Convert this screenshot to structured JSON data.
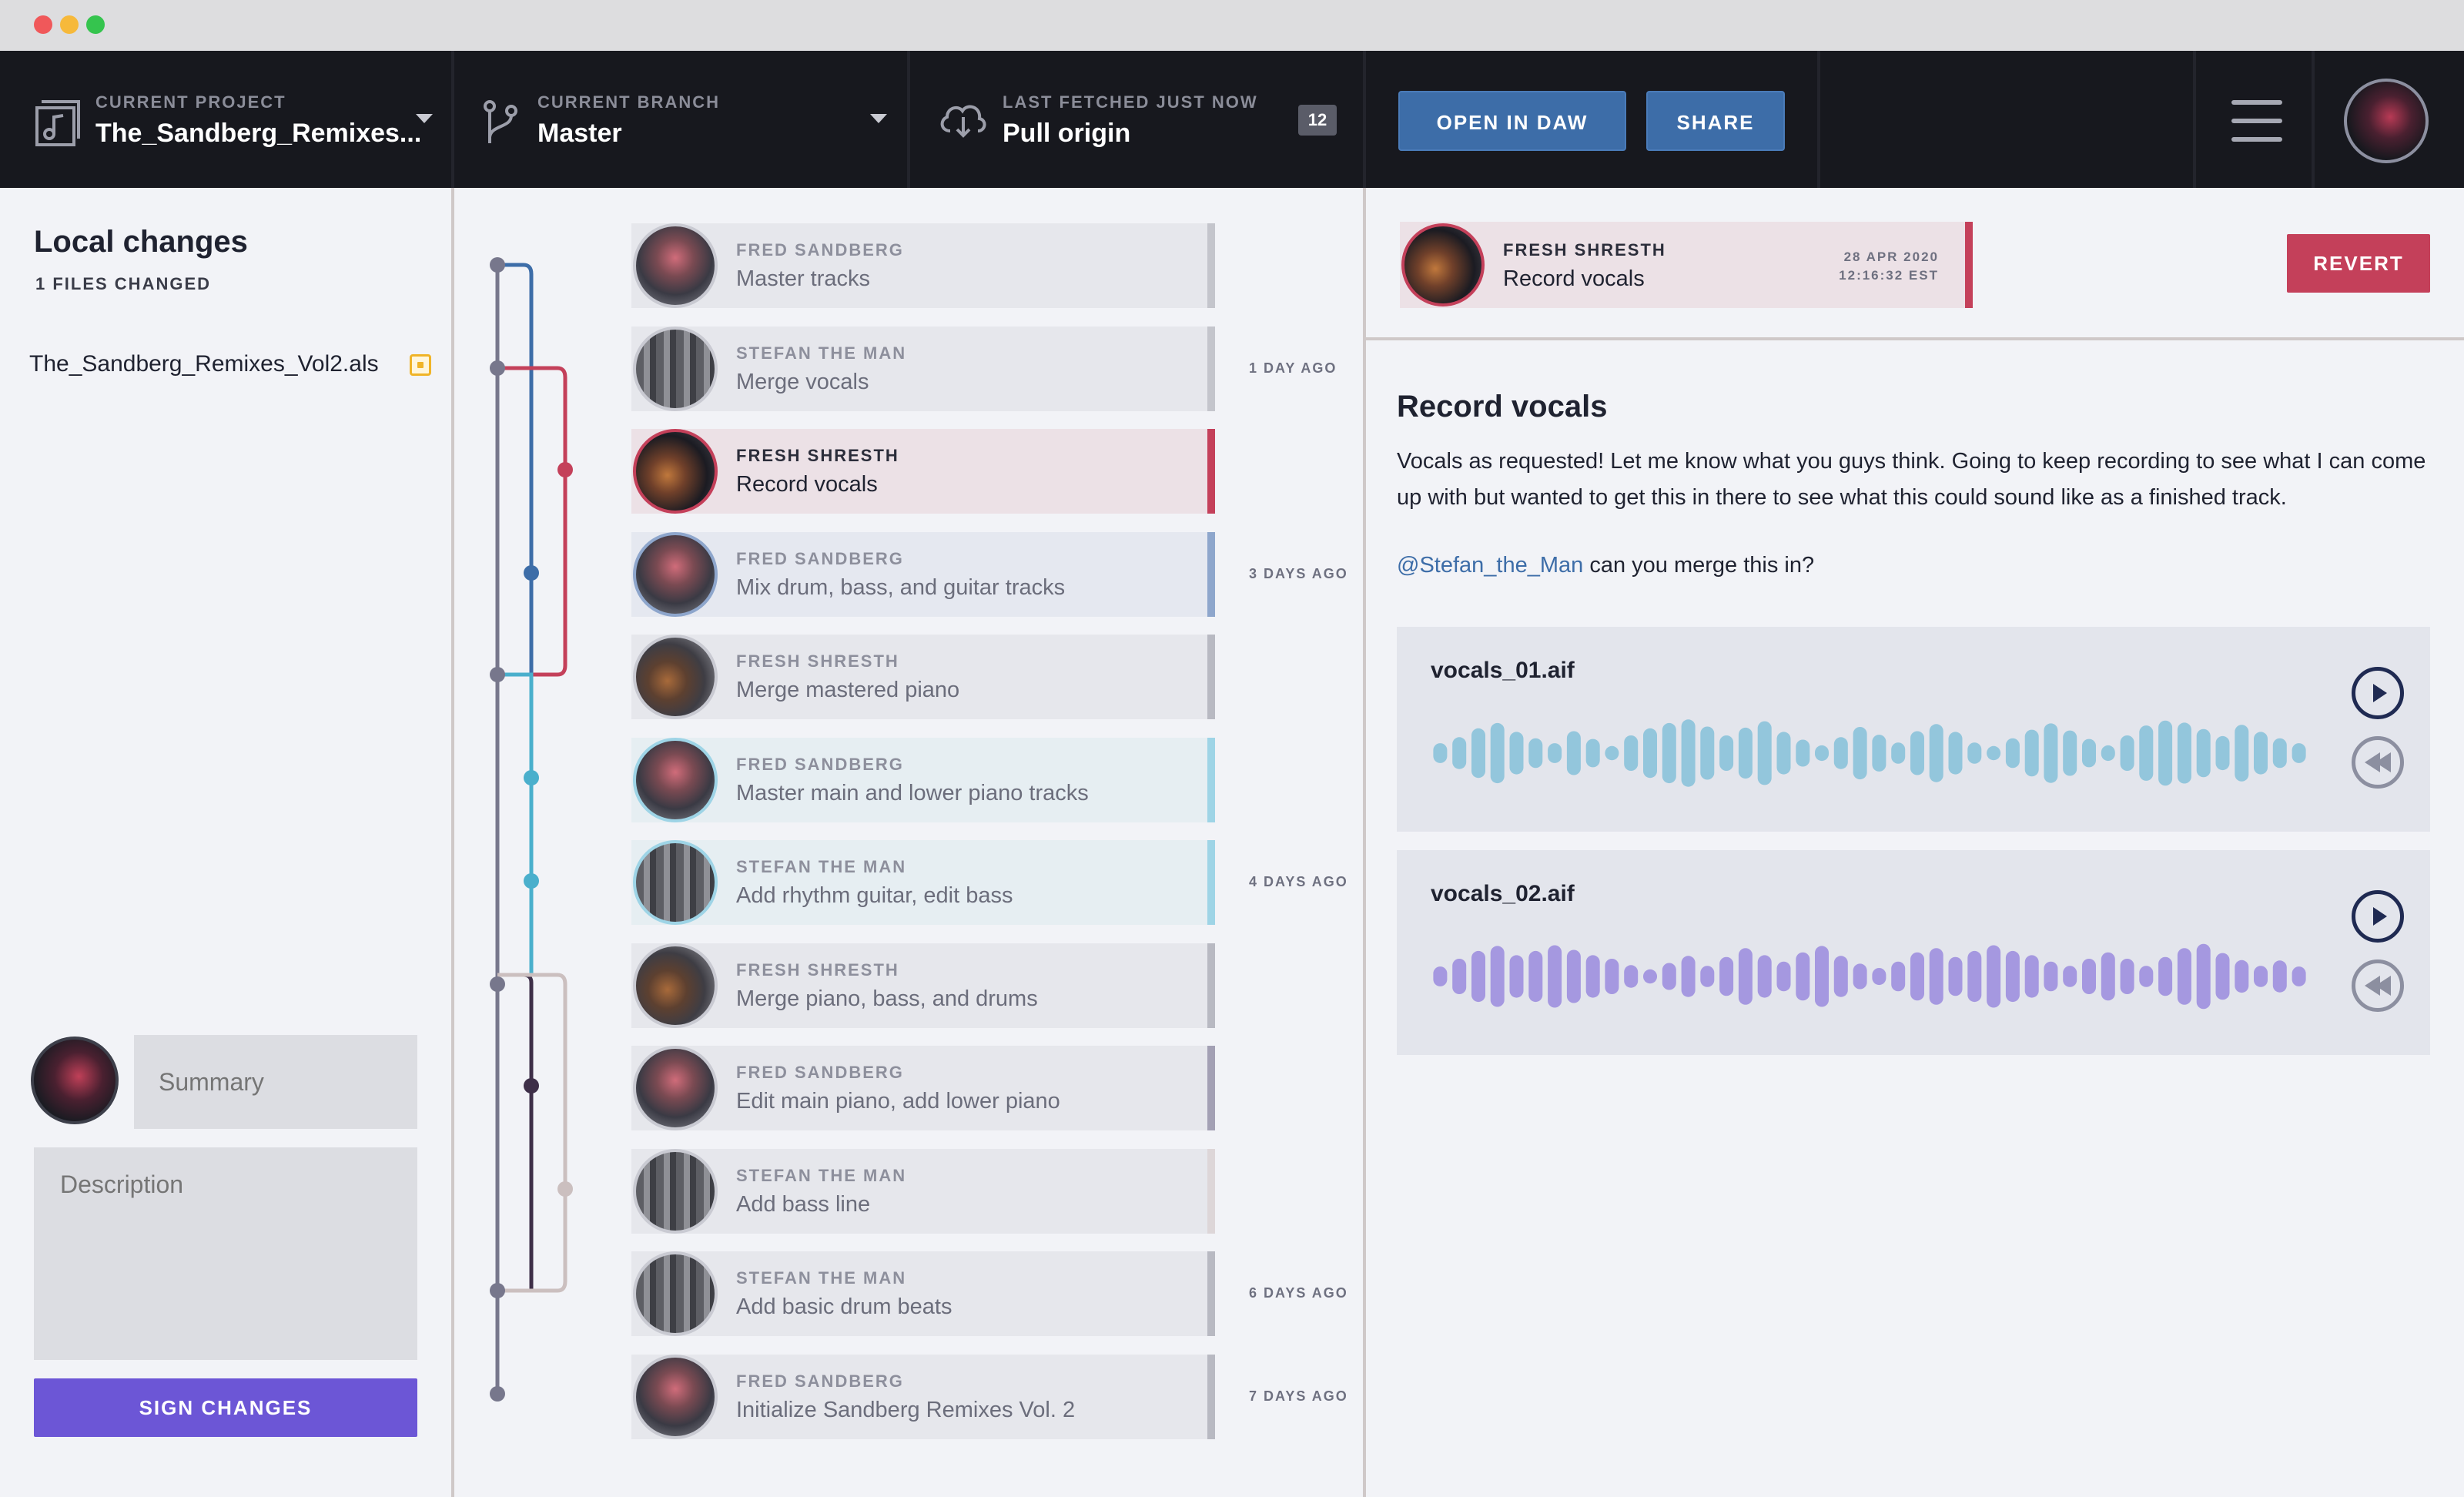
{
  "toolbar": {
    "project_label": "CURRENT PROJECT",
    "project_value": "The_Sandberg_Remixes...",
    "branch_label": "CURRENT BRANCH",
    "branch_value": "Master",
    "fetch_label": "LAST FETCHED JUST NOW",
    "fetch_value": "Pull origin",
    "fetch_count": "12",
    "open_daw_label": "OPEN IN DAW",
    "share_label": "SHARE"
  },
  "local_changes": {
    "title": "Local changes",
    "subtitle": "1 FILES CHANGED",
    "files": [
      "The_Sandberg_Remixes_Vol2.als"
    ],
    "summary_placeholder": "Summary",
    "description_placeholder": "Description",
    "sign_label": "SIGN CHANGES"
  },
  "history": {
    "commits": [
      {
        "author": "FRED SANDBERG",
        "message": "Master tracks",
        "bar_color": "#c4c5cc",
        "avatar": "fred",
        "ago": ""
      },
      {
        "author": "STEFAN THE MAN",
        "message": "Merge vocals",
        "bar_color": "#c4c5cc",
        "avatar": "stefan",
        "ago": "1 DAY AGO"
      },
      {
        "author": "FRESH SHRESTH",
        "message": "Record vocals",
        "bar_color": "#c4405a",
        "avatar": "fresh-color",
        "ago": "",
        "selected": true
      },
      {
        "author": "FRED SANDBERG",
        "message": "Mix drum, bass, and guitar tracks",
        "bar_color": "#8ea6cc",
        "avatar": "fred",
        "ago": "3 DAYS AGO",
        "tint": "blue"
      },
      {
        "author": "FRESH SHRESTH",
        "message": "Merge mastered piano",
        "bar_color": "#b8b9c2",
        "avatar": "fresh",
        "ago": ""
      },
      {
        "author": "FRED SANDBERG",
        "message": "Master main and lower piano tracks",
        "bar_color": "#9ed4e6",
        "avatar": "fred",
        "ago": "",
        "tint": "cyan"
      },
      {
        "author": "STEFAN THE MAN",
        "message": "Add rhythm guitar, edit bass",
        "bar_color": "#9ed4e6",
        "avatar": "stefan",
        "ago": "4 DAYS AGO",
        "tint": "cyan"
      },
      {
        "author": "FRESH SHRESTH",
        "message": "Merge piano, bass, and drums",
        "bar_color": "#b8b9c2",
        "avatar": "fresh",
        "ago": ""
      },
      {
        "author": "FRED SANDBERG",
        "message": "Edit main piano, add lower piano",
        "bar_color": "#a3a0b4",
        "avatar": "fred",
        "ago": ""
      },
      {
        "author": "STEFAN THE MAN",
        "message": "Add bass line",
        "bar_color": "#ddd6d8",
        "avatar": "stefan",
        "ago": ""
      },
      {
        "author": "STEFAN THE MAN",
        "message": "Add basic drum beats",
        "bar_color": "#b8b9c2",
        "avatar": "stefan",
        "ago": "6 DAYS AGO"
      },
      {
        "author": "FRED SANDBERG",
        "message": "Initialize Sandberg Remixes Vol. 2",
        "bar_color": "#b8b9c2",
        "avatar": "fred",
        "ago": "7 DAYS AGO"
      }
    ]
  },
  "detail": {
    "author": "FRESH SHRESTH",
    "message": "Record vocals",
    "date_line1": "28 APR 2020",
    "date_line2": "12:16:32 EST",
    "revert_label": "REVERT",
    "title": "Record vocals",
    "body": "Vocals as requested! Let me know what you guys think. Going to keep recording to see what I can come up with but wanted to get this in there to see what this could sound like as a finished track.",
    "mention": "@Stefan_the_Man",
    "mention_suffix": " can you merge this in?",
    "attachments": [
      {
        "name": "vocals_01.aif",
        "color": "#93c6dc",
        "amplitudes": [
          0.28,
          0.45,
          0.7,
          0.85,
          0.6,
          0.42,
          0.28,
          0.62,
          0.4,
          0.2,
          0.5,
          0.7,
          0.85,
          0.95,
          0.75,
          0.5,
          0.72,
          0.9,
          0.6,
          0.38,
          0.22,
          0.45,
          0.74,
          0.52,
          0.3,
          0.62,
          0.82,
          0.6,
          0.3,
          0.2,
          0.42,
          0.66,
          0.84,
          0.64,
          0.4,
          0.22,
          0.5,
          0.78,
          0.92,
          0.86,
          0.68,
          0.48,
          0.8,
          0.6,
          0.42,
          0.28
        ]
      },
      {
        "name": "vocals_02.aif",
        "color": "#a598e0",
        "amplitudes": [
          0.28,
          0.5,
          0.72,
          0.86,
          0.6,
          0.72,
          0.88,
          0.75,
          0.6,
          0.5,
          0.32,
          0.2,
          0.38,
          0.58,
          0.3,
          0.55,
          0.8,
          0.6,
          0.42,
          0.68,
          0.86,
          0.58,
          0.36,
          0.24,
          0.42,
          0.68,
          0.8,
          0.55,
          0.72,
          0.88,
          0.72,
          0.6,
          0.42,
          0.3,
          0.5,
          0.68,
          0.5,
          0.3,
          0.55,
          0.8,
          0.92,
          0.66,
          0.46,
          0.3,
          0.45,
          0.28
        ]
      }
    ]
  },
  "graph": {
    "colors": {
      "main": "#77778c",
      "blue": "#3d6da8",
      "red": "#c4405a",
      "cyan": "#4aafcc",
      "dark": "#3e2f48",
      "beige": "#cbbfbf"
    }
  }
}
